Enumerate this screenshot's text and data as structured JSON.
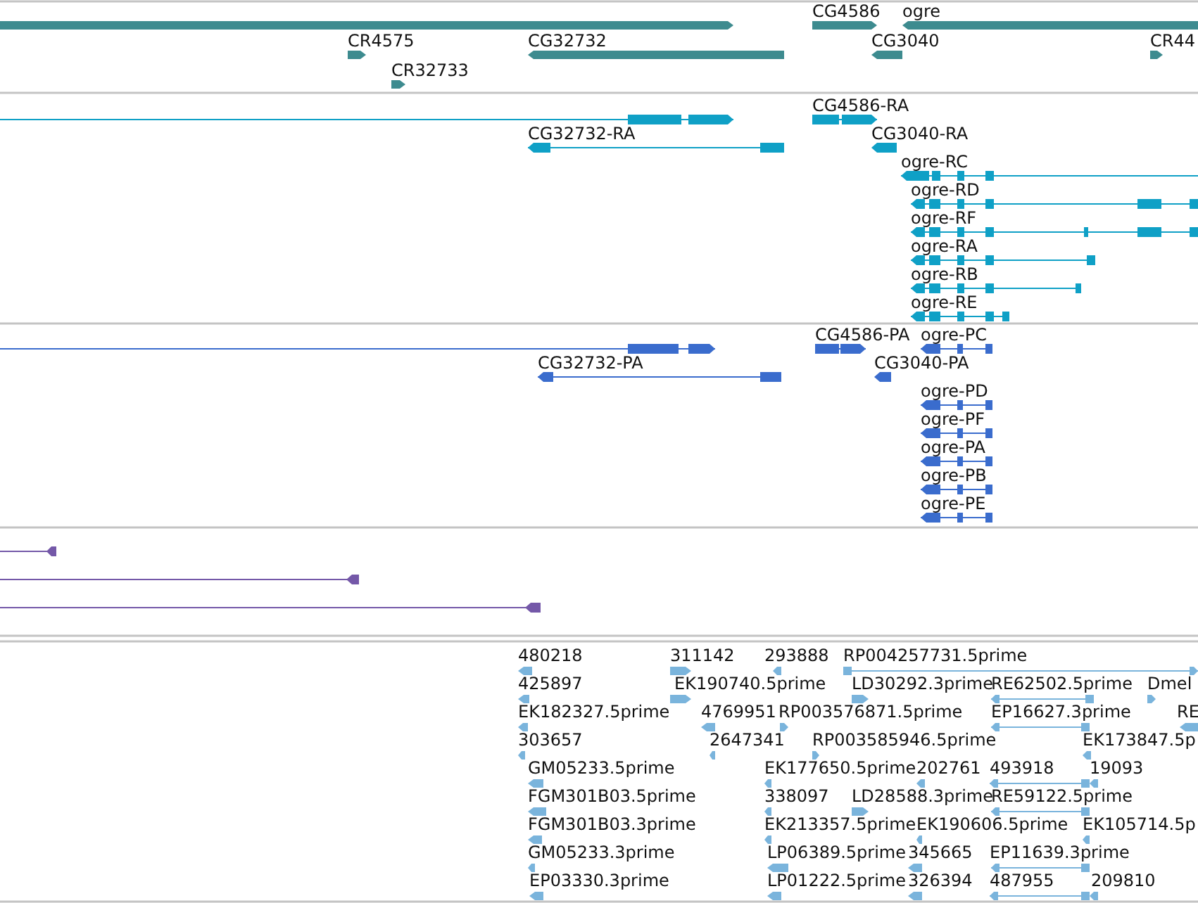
{
  "tracks": [
    {
      "kind": "gene",
      "features": [
        {
          "reverse": false
        },
        {
          "label": "CG4586",
          "reverse": false
        },
        {
          "label": "ogre",
          "reverse": true
        },
        {
          "label": "CR4575",
          "reverse": false
        },
        {
          "label": "CG32732",
          "reverse": true
        },
        {
          "label": "CG3040",
          "reverse": true
        },
        {
          "label": "CR44",
          "reverse": false
        },
        {
          "label": "CR32733",
          "reverse": false
        }
      ]
    },
    {
      "kind": "transcript",
      "features": [
        {
          "reverse": false
        },
        {
          "label": "CG4586-RA",
          "reverse": false
        },
        {
          "label": "CG32732-RA",
          "reverse": true
        },
        {
          "label": "CG3040-RA",
          "reverse": true
        },
        {
          "label": "ogre-RC",
          "reverse": true
        },
        {
          "label": "ogre-RD",
          "reverse": true
        },
        {
          "label": "ogre-RF",
          "reverse": true
        },
        {
          "label": "ogre-RA",
          "reverse": true
        },
        {
          "label": "ogre-RB",
          "reverse": true
        },
        {
          "label": "ogre-RE",
          "reverse": true
        }
      ]
    },
    {
      "kind": "protein",
      "features": [
        {
          "reverse": false
        },
        {
          "label": "CG4586-PA",
          "reverse": false
        },
        {
          "label": "ogre-PC",
          "reverse": true
        },
        {
          "label": "CG32732-PA",
          "reverse": true
        },
        {
          "label": "CG3040-PA",
          "reverse": true
        },
        {
          "label": "ogre-PD",
          "reverse": true
        },
        {
          "label": "ogre-PF",
          "reverse": true
        },
        {
          "label": "ogre-PA",
          "reverse": true
        },
        {
          "label": "ogre-PB",
          "reverse": true
        },
        {
          "label": "ogre-PE",
          "reverse": true
        }
      ]
    },
    {
      "kind": "match",
      "features": [
        {
          "reverse": true
        },
        {
          "reverse": true
        },
        {
          "reverse": true
        }
      ]
    },
    {
      "kind": "est",
      "features": [
        {
          "label": "480218",
          "reverse": true
        },
        {
          "label": "311142",
          "reverse": false
        },
        {
          "label": "293888",
          "reverse": true
        },
        {
          "label": "RP004257731.5prime",
          "reverse": false
        },
        {
          "label": "425897",
          "reverse": true
        },
        {
          "label": "EK190740.5prime",
          "reverse": false
        },
        {
          "label": "LD30292.3prime",
          "reverse": false
        },
        {
          "label": "RE62502.5prime",
          "reverse": true
        },
        {
          "label": "Dmel",
          "reverse": false
        },
        {
          "label": "EK182327.5prime",
          "reverse": true
        },
        {
          "label": "4769951",
          "reverse": true
        },
        {
          "label": "RP003576871.5prime",
          "reverse": false
        },
        {
          "label": "EP16627.3prime",
          "reverse": true
        },
        {
          "label": "RE",
          "reverse": true
        },
        {
          "label": "303657",
          "reverse": true
        },
        {
          "label": "2647341",
          "reverse": true
        },
        {
          "label": "RP003585946.5prime",
          "reverse": false
        },
        {
          "label": "EK173847.5p",
          "reverse": true
        },
        {
          "label": "GM05233.5prime",
          "reverse": true
        },
        {
          "label": "EK177650.5prime",
          "reverse": true
        },
        {
          "label": "202761",
          "reverse": true
        },
        {
          "label": "493918",
          "reverse": true
        },
        {
          "label": "19093",
          "reverse": true
        },
        {
          "label": "FGM301B03.5prime",
          "reverse": true
        },
        {
          "label": "338097",
          "reverse": true
        },
        {
          "label": "LD28588.3prime",
          "reverse": false
        },
        {
          "label": "RE59122.5prime",
          "reverse": true
        },
        {
          "label": "FGM301B03.3prime",
          "reverse": true
        },
        {
          "label": "EK213357.5prime",
          "reverse": true
        },
        {
          "label": "EK190606.5prime",
          "reverse": true
        },
        {
          "label": "EK105714.5p",
          "reverse": true
        },
        {
          "label": "GM05233.3prime",
          "reverse": true
        },
        {
          "label": "LP06389.5prime",
          "reverse": true
        },
        {
          "label": "345665",
          "reverse": true
        },
        {
          "label": "EP11639.3prime",
          "reverse": true
        },
        {
          "label": "EP03330.3prime",
          "reverse": true
        },
        {
          "label": "LP01222.5prime",
          "reverse": true
        },
        {
          "label": "326394",
          "reverse": true
        },
        {
          "label": "487955",
          "reverse": true
        },
        {
          "label": "209810",
          "reverse": true
        }
      ]
    }
  ]
}
